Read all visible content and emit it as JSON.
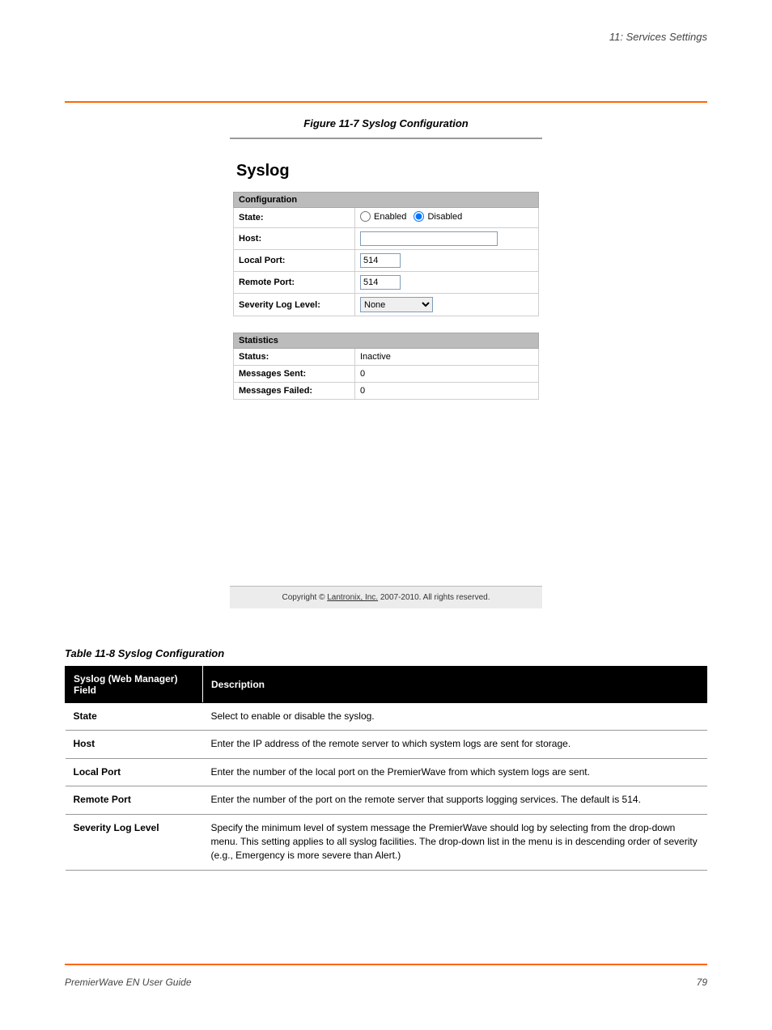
{
  "header": {
    "chapter_label": "11: Services Settings"
  },
  "figure": {
    "caption": "Figure 11-7 Syslog Configuration"
  },
  "syslog_ui": {
    "title": "Syslog",
    "config_section": "Configuration",
    "labels": {
      "state": "State:",
      "host": "Host:",
      "local_port": "Local Port:",
      "remote_port": "Remote Port:",
      "severity": "Severity Log Level:"
    },
    "state_options": {
      "enabled": "Enabled",
      "disabled": "Disabled"
    },
    "state_selected": "disabled",
    "values": {
      "host": "",
      "local_port": "514",
      "remote_port": "514",
      "severity": "None"
    },
    "stats_section": "Statistics",
    "stats": {
      "status_label": "Status:",
      "status_value": "Inactive",
      "sent_label": "Messages Sent:",
      "sent_value": "0",
      "failed_label": "Messages Failed:",
      "failed_value": "0"
    },
    "footer_prefix": "Copyright © ",
    "footer_link": "Lantronix, Inc.",
    "footer_suffix": " 2007-2010. All rights reserved."
  },
  "table": {
    "caption": "Table 11-8 Syslog Configuration",
    "headers": {
      "field": "Syslog   (Web Manager) Field",
      "description": "Description"
    },
    "rows": [
      {
        "field": "State",
        "description": "Select to enable or disable the syslog."
      },
      {
        "field": "Host",
        "description": "Enter the IP address of the remote server to which system logs are sent for storage."
      },
      {
        "field": "Local Port",
        "description": "Enter the number of the local port on the PremierWave from which system logs are sent."
      },
      {
        "field": "Remote Port",
        "description": "Enter the number of the port on the remote server that supports logging services. The default is 514."
      },
      {
        "field": "Severity Log Level",
        "description": "Specify the minimum level of system message the PremierWave should log by selecting from the drop-down menu. This setting applies to all syslog facilities. The drop-down list in the menu is in descending order of severity (e.g., Emergency is more severe than Alert.)"
      }
    ]
  },
  "footer": {
    "doc_title": "PremierWave EN User Guide",
    "page_number": "79"
  }
}
